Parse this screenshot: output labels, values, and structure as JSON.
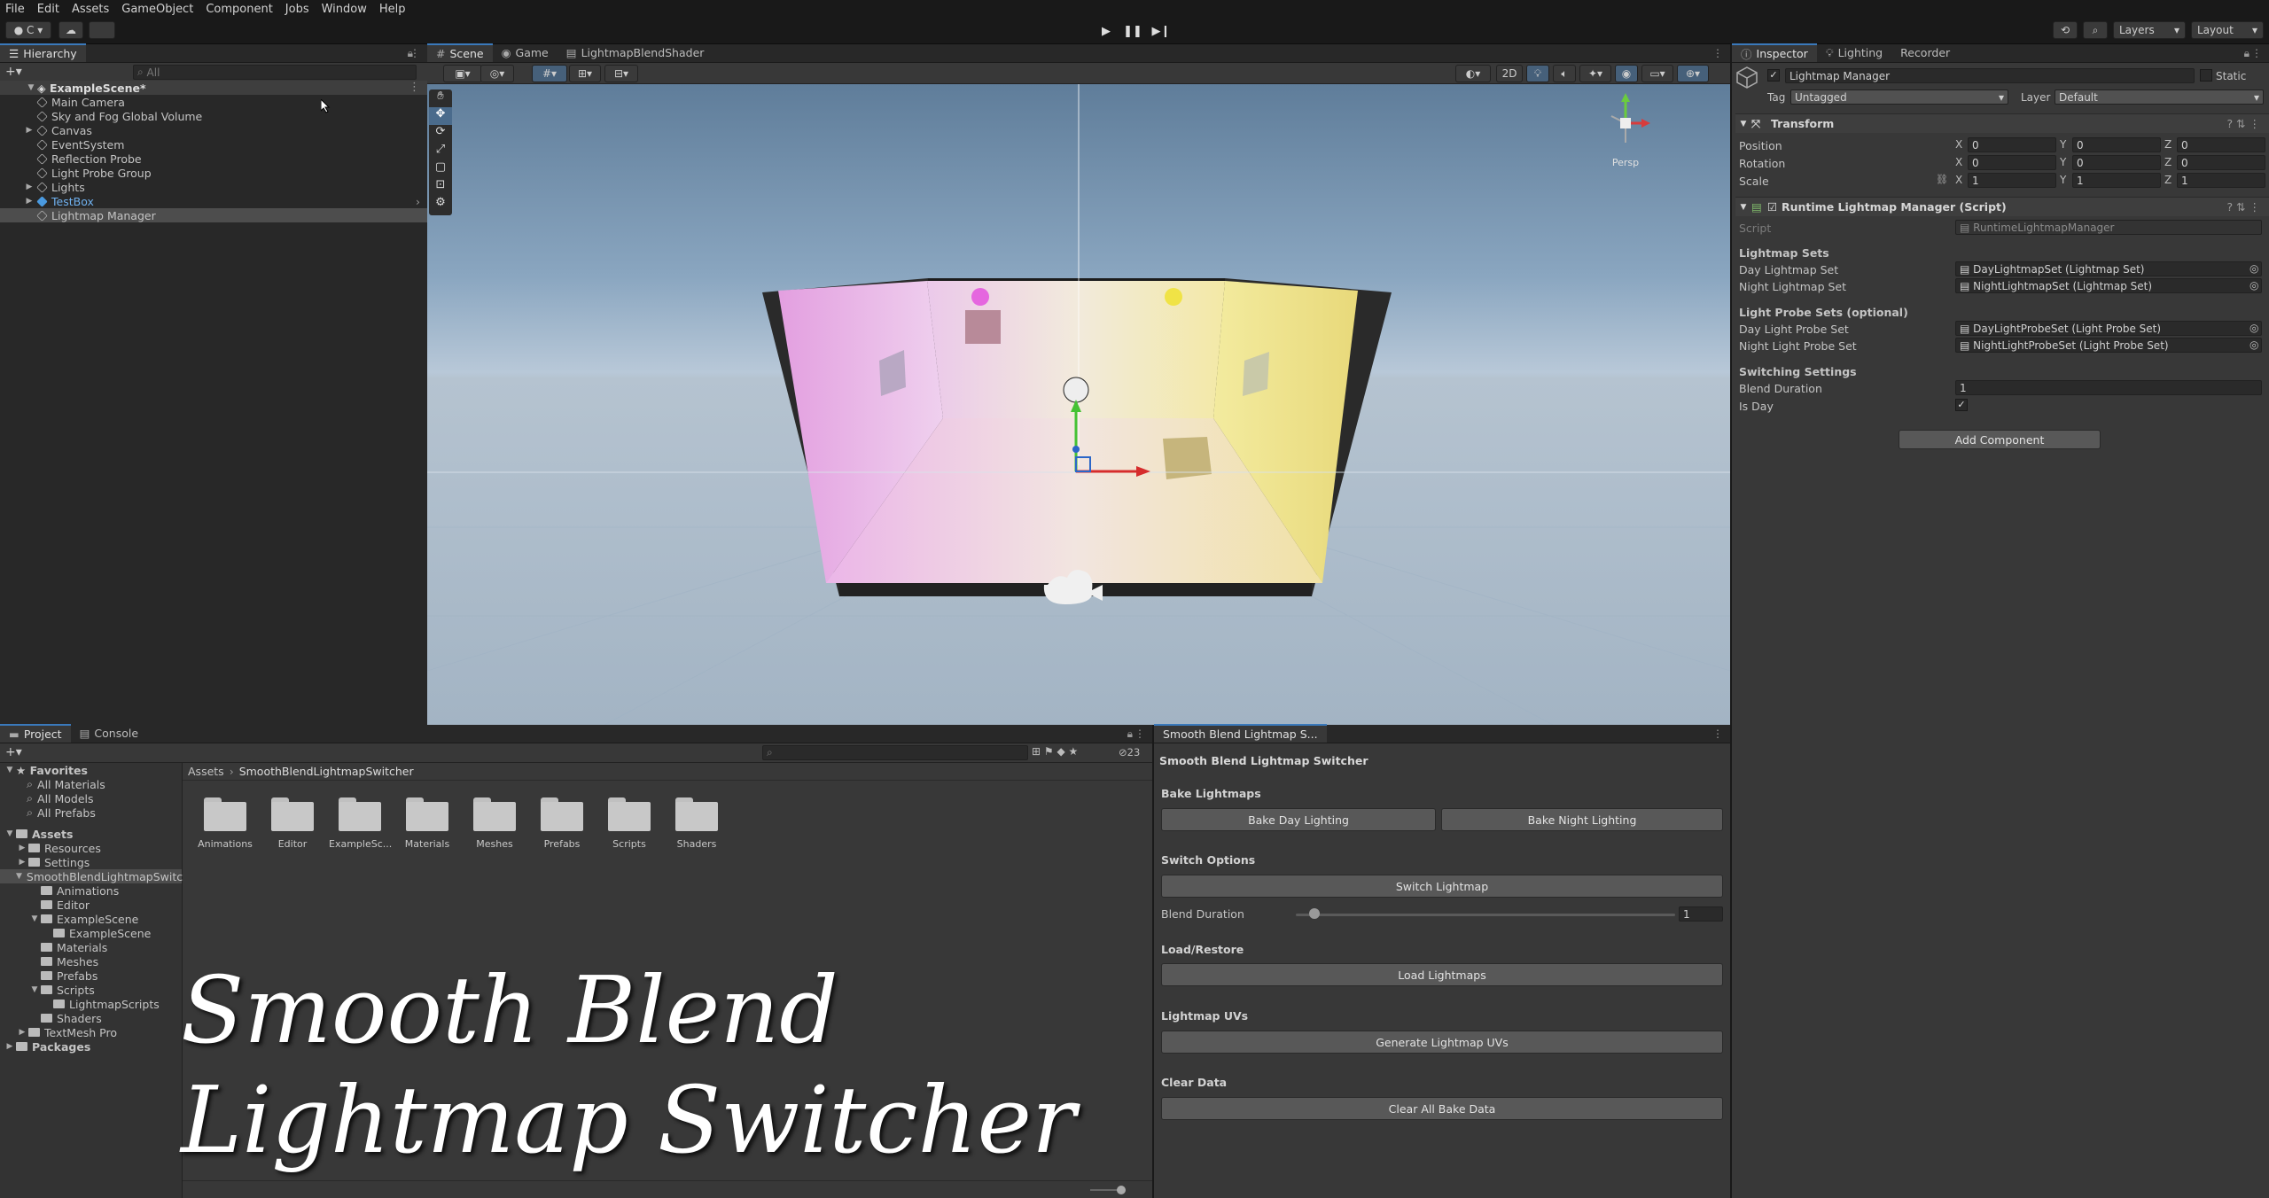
{
  "menubar": [
    "File",
    "Edit",
    "Assets",
    "GameObject",
    "Component",
    "Jobs",
    "Window",
    "Help"
  ],
  "toolbar": {
    "account_label": "C",
    "layers_label": "Layers",
    "layout_label": "Layout"
  },
  "hierarchy": {
    "tab": "Hierarchy",
    "search_placeholder": "All",
    "scene": "ExampleScene*",
    "items": [
      {
        "label": "Main Camera",
        "depth": 1,
        "expandable": false
      },
      {
        "label": "Sky and Fog Global Volume",
        "depth": 1,
        "expandable": false
      },
      {
        "label": "Canvas",
        "depth": 1,
        "expandable": true
      },
      {
        "label": "EventSystem",
        "depth": 1,
        "expandable": false
      },
      {
        "label": "Reflection Probe",
        "depth": 1,
        "expandable": false
      },
      {
        "label": "Light Probe Group",
        "depth": 1,
        "expandable": false
      },
      {
        "label": "Lights",
        "depth": 1,
        "expandable": true
      },
      {
        "label": "TestBox",
        "depth": 1,
        "expandable": true,
        "prefab": true
      },
      {
        "label": "Lightmap Manager",
        "depth": 1,
        "expandable": false,
        "selected": true
      }
    ]
  },
  "scene_tabs": [
    "Scene",
    "Game",
    "LightmapBlendShader"
  ],
  "scene_overlay": {
    "view_2d": "2D",
    "persp": "Persp"
  },
  "inspector": {
    "tabs": [
      "Inspector",
      "Lighting",
      "Recorder"
    ],
    "object_name": "Lightmap Manager",
    "static_label": "Static",
    "tag_label": "Tag",
    "tag_value": "Untagged",
    "layer_label": "Layer",
    "layer_value": "Default",
    "transform": {
      "title": "Transform",
      "rows": [
        {
          "label": "Position",
          "x": "0",
          "y": "0",
          "z": "0"
        },
        {
          "label": "Rotation",
          "x": "0",
          "y": "0",
          "z": "0"
        },
        {
          "label": "Scale",
          "x": "1",
          "y": "1",
          "z": "1"
        }
      ],
      "axis": [
        "X",
        "Y",
        "Z"
      ]
    },
    "script_comp": {
      "title": "Runtime Lightmap Manager (Script)",
      "script_label": "Script",
      "script_value": "RuntimeLightmapManager",
      "lightmap_sets": "Lightmap Sets",
      "day_set_label": "Day Lightmap Set",
      "day_set_value": "DayLightmapSet (Lightmap Set)",
      "night_set_label": "Night Lightmap Set",
      "night_set_value": "NightLightmapSet (Lightmap Set)",
      "probe_sets": "Light Probe Sets (optional)",
      "day_probe_label": "Day Light Probe Set",
      "day_probe_value": "DayLightProbeSet (Light Probe Set)",
      "night_probe_label": "Night Light Probe Set",
      "night_probe_value": "NightLightProbeSet (Light Probe Set)",
      "switching": "Switching Settings",
      "blend_label": "Blend Duration",
      "blend_value": "1",
      "isday_label": "Is Day",
      "isday_check": "✓"
    },
    "add_component": "Add Component"
  },
  "project": {
    "tabs": [
      "Project",
      "Console"
    ],
    "hidden_count": "23",
    "favorites_label": "Favorites",
    "favorites": [
      "All Materials",
      "All Models",
      "All Prefabs"
    ],
    "tree": [
      {
        "label": "Assets",
        "depth": 0,
        "open": true,
        "bold": true
      },
      {
        "label": "Resources",
        "depth": 1,
        "open": false
      },
      {
        "label": "Settings",
        "depth": 1,
        "open": false
      },
      {
        "label": "SmoothBlendLightmapSwitc",
        "depth": 1,
        "open": true,
        "selected": true
      },
      {
        "label": "Animations",
        "depth": 2
      },
      {
        "label": "Editor",
        "depth": 2
      },
      {
        "label": "ExampleScene",
        "depth": 2,
        "open": true
      },
      {
        "label": "ExampleScene",
        "depth": 3
      },
      {
        "label": "Materials",
        "depth": 2
      },
      {
        "label": "Meshes",
        "depth": 2
      },
      {
        "label": "Prefabs",
        "depth": 2
      },
      {
        "label": "Scripts",
        "depth": 2,
        "open": true
      },
      {
        "label": "LightmapScripts",
        "depth": 3
      },
      {
        "label": "Shaders",
        "depth": 2
      },
      {
        "label": "TextMesh Pro",
        "depth": 1,
        "open": false
      },
      {
        "label": "Packages",
        "depth": 0,
        "open": false,
        "bold": true
      }
    ],
    "breadcrumb": [
      "Assets",
      "SmoothBlendLightmapSwitcher"
    ],
    "folders": [
      "Animations",
      "Editor",
      "ExampleSc...",
      "Materials",
      "Meshes",
      "Prefabs",
      "Scripts",
      "Shaders"
    ]
  },
  "switcher": {
    "tab": "Smooth Blend Lightmap S...",
    "title": "Smooth Blend Lightmap Switcher",
    "bake_header": "Bake Lightmaps",
    "bake_day": "Bake Day Lighting",
    "bake_night": "Bake Night Lighting",
    "switch_header": "Switch Options",
    "switch_btn": "Switch Lightmap",
    "blend_label": "Blend Duration",
    "blend_value": "1",
    "blend_fraction": 0.05,
    "load_header": "Load/Restore",
    "load_btn": "Load Lightmaps",
    "uv_header": "Lightmap UVs",
    "uv_btn": "Generate Lightmap UVs",
    "clear_header": "Clear Data",
    "clear_btn": "Clear All Bake Data"
  },
  "overlay_title": {
    "line1": "Smooth Blend",
    "line2": "Lightmap Switcher"
  }
}
